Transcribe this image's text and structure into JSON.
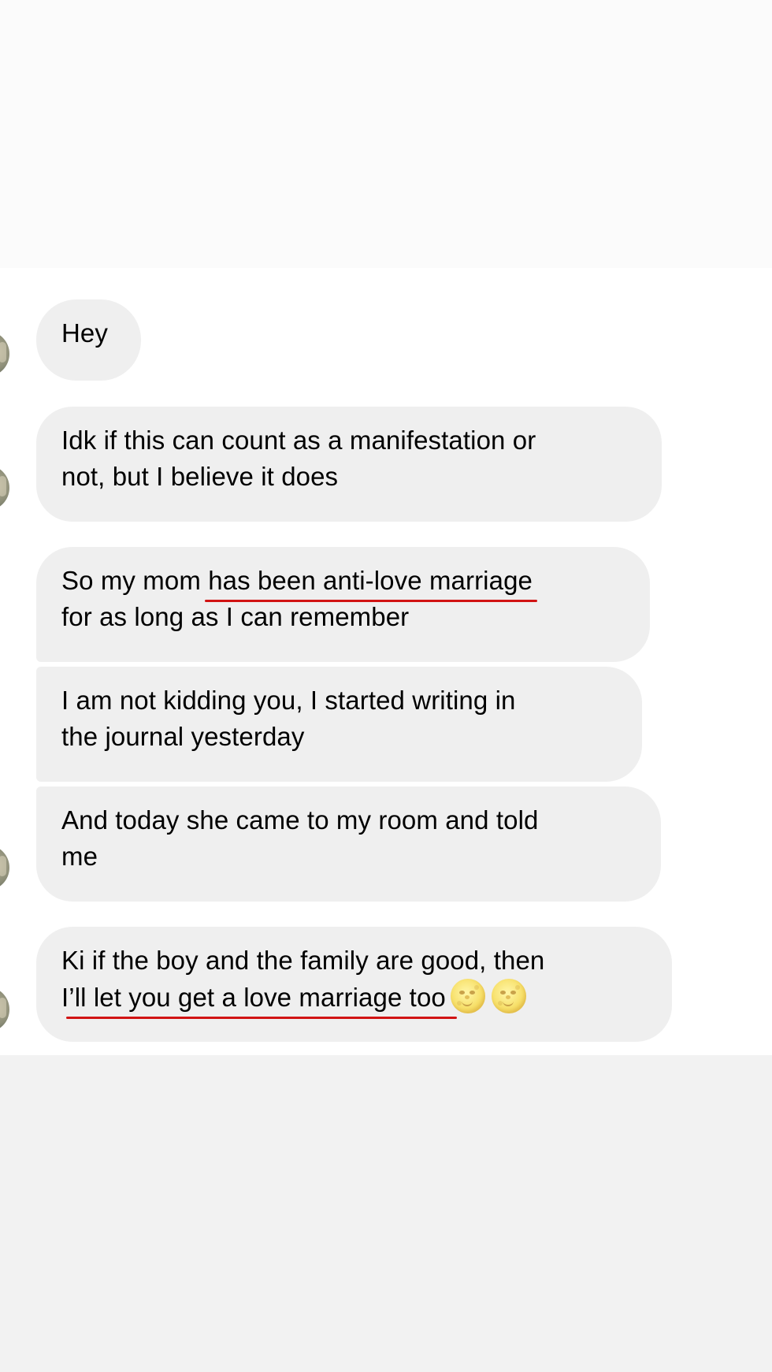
{
  "messages": [
    {
      "lines": [
        "Hey"
      ]
    },
    {
      "lines": [
        "Idk if this can count as a manifestation or",
        "not, but I believe it does"
      ]
    },
    {
      "line1_before": "So my mom ",
      "line1_underlined": "has been anti-love marriage",
      "line2": "for as long as I can remember"
    },
    {
      "lines": [
        "I am not kidding you, I started writing in",
        "the journal yesterday"
      ]
    },
    {
      "lines": [
        "And today she came to my room and told",
        "me"
      ]
    },
    {
      "line1": "Ki if the boy and the family are good, then",
      "line2_underlined": "I’ll let you get a love marriage too",
      "emoji": "full-moon-face",
      "emoji_count": 2
    }
  ],
  "colors": {
    "bubble_bg": "#efefef",
    "text": "#000000",
    "underline": "#d11313",
    "chat_bg": "#ffffff",
    "outer_bg": "#f2f2f2"
  }
}
